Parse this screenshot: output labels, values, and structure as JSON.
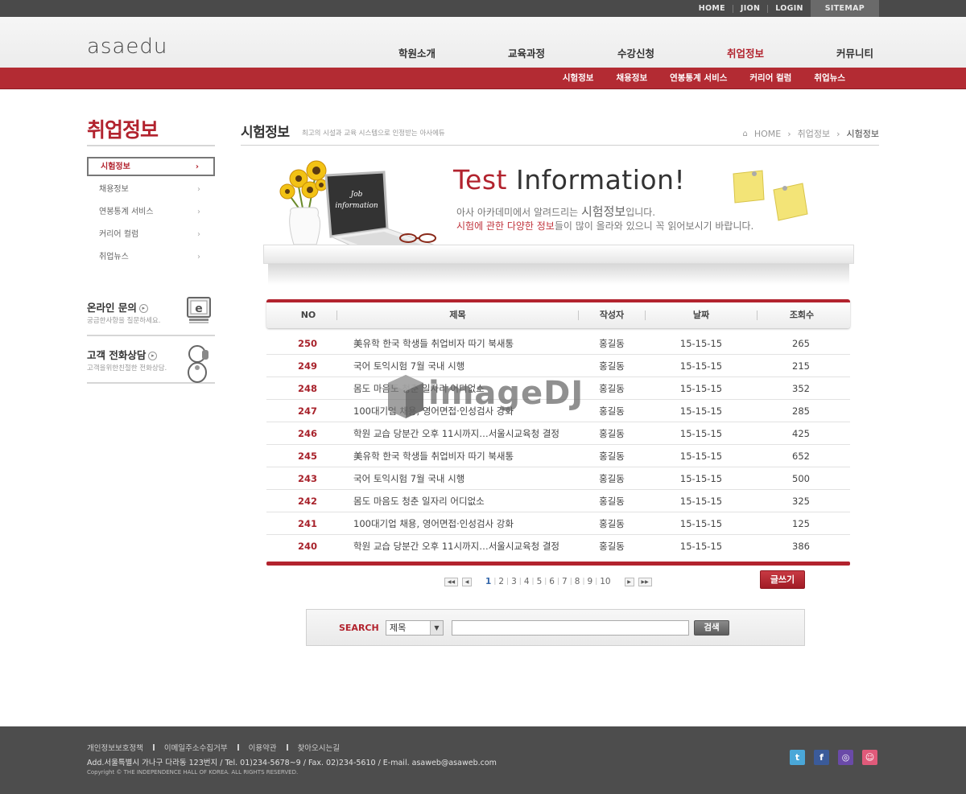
{
  "util_nav": [
    "HOME",
    "JION",
    "LOGIN",
    "SITEMAP"
  ],
  "logo": "asaedu",
  "gnb": [
    "학원소개",
    "교육과정",
    "수강신청",
    "취업정보",
    "커뮤니티"
  ],
  "snb": [
    "시험정보",
    "채용정보",
    "연봉통계 서비스",
    "커리어 컬럼",
    "취업뉴스"
  ],
  "sidebar": {
    "title": "취업정보",
    "items": [
      {
        "label": "시험정보"
      },
      {
        "label": "채용정보"
      },
      {
        "label": "연봉통계 서비스"
      },
      {
        "label": "커리어 컬럼"
      },
      {
        "label": "취업뉴스"
      }
    ],
    "contacts": [
      {
        "title": "온라인 문의",
        "sub": "궁금한사항을 질문하세요.",
        "icon": "monitor-e-icon"
      },
      {
        "title": "고객 전화상담",
        "sub": "고객을위한친절한 전화상담.",
        "icon": "phone-person-icon"
      }
    ]
  },
  "content": {
    "title": "시험정보",
    "subtitle": "최고의 시설과 교육 시스템으로 인정받는 아사에듀",
    "breadcrumb": [
      "HOME",
      "취업정보",
      "시험정보"
    ]
  },
  "banner": {
    "title_red": "Test",
    "title_rest": "Information!",
    "line1_pre": "아사 아카데미에서 알려드리는",
    "line1_big": "시험정보",
    "line1_post": "입니다.",
    "line2_hl": "시험에 관한 다양한 정보",
    "line2_post": "들이 많이 올라와 있으니 꼭 읽어보시기 바랍니다.",
    "laptop_text": "Job information"
  },
  "table": {
    "headers": [
      "NO",
      "제목",
      "작성자",
      "날짜",
      "조회수"
    ],
    "rows": [
      {
        "no": "250",
        "subject": "美유학 한국 학생들 취업비자 따기 북새통",
        "writer": "홍길동",
        "date": "15-15-15",
        "views": "265"
      },
      {
        "no": "249",
        "subject": "국어 토익시험 7월 국내 시행",
        "writer": "홍길동",
        "date": "15-15-15",
        "views": "215"
      },
      {
        "no": "248",
        "subject": "몸도 마음도 청춘 일자리 어디없소",
        "writer": "홍길동",
        "date": "15-15-15",
        "views": "352"
      },
      {
        "no": "247",
        "subject": "100대기업 채용, 영어면접·인성검사 강화",
        "writer": "홍길동",
        "date": "15-15-15",
        "views": "285"
      },
      {
        "no": "246",
        "subject": "학원 교습 당분간 오후 11시까지…서울시교육청 결정",
        "writer": "홍길동",
        "date": "15-15-15",
        "views": "425"
      },
      {
        "no": "245",
        "subject": "美유학 한국 학생들 취업비자 따기 북새통",
        "writer": "홍길동",
        "date": "15-15-15",
        "views": "652"
      },
      {
        "no": "243",
        "subject": "국어 토익시험 7월 국내 시행",
        "writer": "홍길동",
        "date": "15-15-15",
        "views": "500"
      },
      {
        "no": "242",
        "subject": "몸도 마음도 청춘 일자리 어디없소",
        "writer": "홍길동",
        "date": "15-15-15",
        "views": "325"
      },
      {
        "no": "241",
        "subject": "100대기업 채용, 영어면접·인성검사 강화",
        "writer": "홍길동",
        "date": "15-15-15",
        "views": "125"
      },
      {
        "no": "240",
        "subject": "학원 교습 당분간 오후 11시까지…서울시교육청 결정",
        "writer": "홍길동",
        "date": "15-15-15",
        "views": "386"
      }
    ]
  },
  "paging": {
    "pages": [
      "1",
      "2",
      "3",
      "4",
      "5",
      "6",
      "7",
      "8",
      "9",
      "10"
    ],
    "current": "1"
  },
  "write_button": "글쓰기",
  "search": {
    "label": "SEARCH",
    "select_value": "제목",
    "button": "검색"
  },
  "footer": {
    "links": [
      "개인정보보호정책",
      "이메일주소수집거부",
      "이용약관",
      "찾아오시는길"
    ],
    "address": "Add.서울특별시 가나구 다라동 123번지  / Tel. 01)234-5678~9  / Fax. 02)234-5610  / E-mail. asaweb@asaweb.com",
    "copyright": "Copyright © THE INDEPENDENCE HALL OF KOREA. ALL RIGHTS RESERVED.",
    "sns": [
      {
        "name": "twitter-icon",
        "glyph": "t",
        "color": "#4aa7d8"
      },
      {
        "name": "facebook-icon",
        "glyph": "f",
        "color": "#3b5b9a"
      },
      {
        "name": "me2day-icon",
        "glyph": "◎",
        "color": "#6a4aa8"
      },
      {
        "name": "yozm-icon",
        "glyph": "☺",
        "color": "#e05a7a"
      }
    ]
  },
  "watermark": "imageDJ"
}
